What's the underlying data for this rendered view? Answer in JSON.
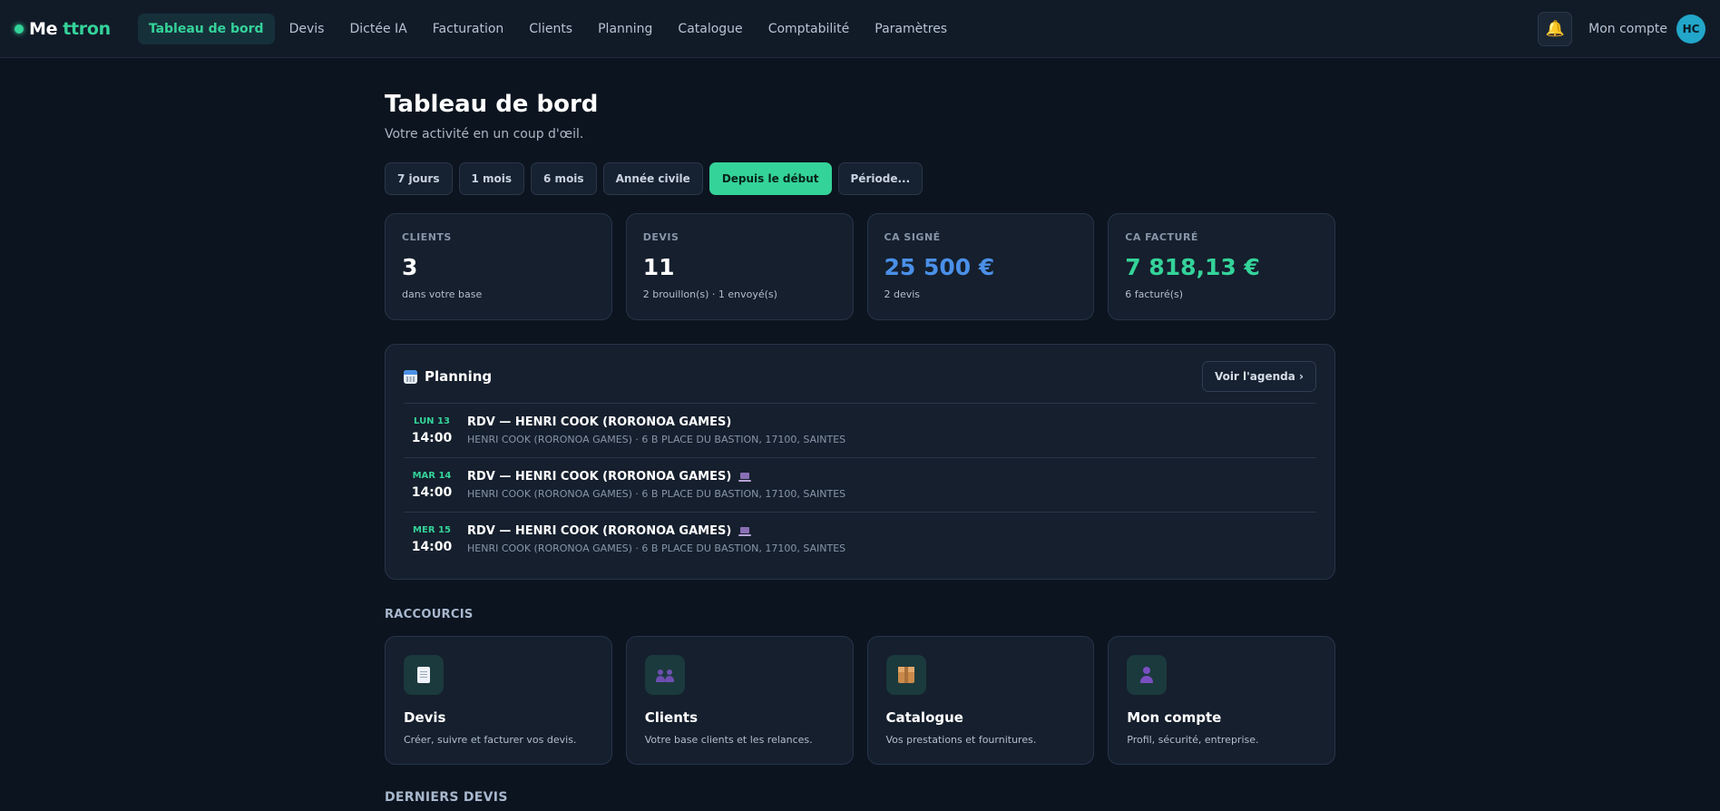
{
  "brand": {
    "name": "Me",
    "accent": "ttron"
  },
  "nav": {
    "items": [
      {
        "label": "Tableau de bord",
        "active": true
      },
      {
        "label": "Devis"
      },
      {
        "label": "Dictée IA"
      },
      {
        "label": "Facturation"
      },
      {
        "label": "Clients"
      },
      {
        "label": "Planning"
      },
      {
        "label": "Catalogue"
      },
      {
        "label": "Comptabilité"
      },
      {
        "label": "Paramètres"
      }
    ],
    "account_label": "Mon compte",
    "avatar_initials": "HC",
    "bell_icon": "bell-icon"
  },
  "page": {
    "title": "Tableau de bord",
    "subtitle": "Votre activité en un coup d'œil."
  },
  "periods": [
    "7 jours",
    "1 mois",
    "6 mois",
    "Année civile",
    "Depuis le début",
    "Période..."
  ],
  "active_period": "Depuis le début",
  "stats": [
    {
      "label": "CLIENTS",
      "value": "3",
      "sub": "dans votre base"
    },
    {
      "label": "DEVIS",
      "value": "11",
      "sub": "2 brouillon(s) · 1 envoyé(s)"
    },
    {
      "label": "CA SIGNÉ",
      "value": "25 500 €",
      "sub": "2 devis"
    },
    {
      "label": "CA FACTURÉ",
      "value": "7 818,13 €",
      "sub": "6 facturé(s)"
    }
  ],
  "planning": {
    "title": "Planning",
    "agenda_button": "Voir l'agenda ›",
    "events": [
      {
        "day": "LUN 13",
        "time": "14:00",
        "title": "RDV — HENRI COOK (RORONOA GAMES)",
        "address": "HENRI COOK (RORONOA GAMES) · 6 B PLACE DU BASTION, 17100, SAINTES",
        "visio": false
      },
      {
        "day": "MAR 14",
        "time": "14:00",
        "title": "RDV — HENRI COOK (RORONOA GAMES)",
        "address": "HENRI COOK (RORONOA GAMES) · 6 B PLACE DU BASTION, 17100, SAINTES",
        "visio": true
      },
      {
        "day": "MER 15",
        "time": "14:00",
        "title": "RDV — HENRI COOK (RORONOA GAMES)",
        "address": "HENRI COOK (RORONOA GAMES) · 6 B PLACE DU BASTION, 17100, SAINTES",
        "visio": true
      }
    ]
  },
  "shortcuts": {
    "title": "RACCOURCIS",
    "items": [
      {
        "title": "Devis",
        "desc": "Créer, suivre et facturer vos devis.",
        "icon": "document-icon"
      },
      {
        "title": "Clients",
        "desc": "Votre base clients et les relances.",
        "icon": "users-icon"
      },
      {
        "title": "Catalogue",
        "desc": "Vos prestations et fournitures.",
        "icon": "package-icon"
      },
      {
        "title": "Mon compte",
        "desc": "Profil, sécurité, entreprise.",
        "icon": "user-icon"
      }
    ]
  },
  "last_quotes": {
    "title": "DERNIERS DEVIS"
  },
  "colors": {
    "accent": "#34d399",
    "blue": "#4a90e8",
    "background": "#0c141f",
    "card": "#151f2d"
  }
}
